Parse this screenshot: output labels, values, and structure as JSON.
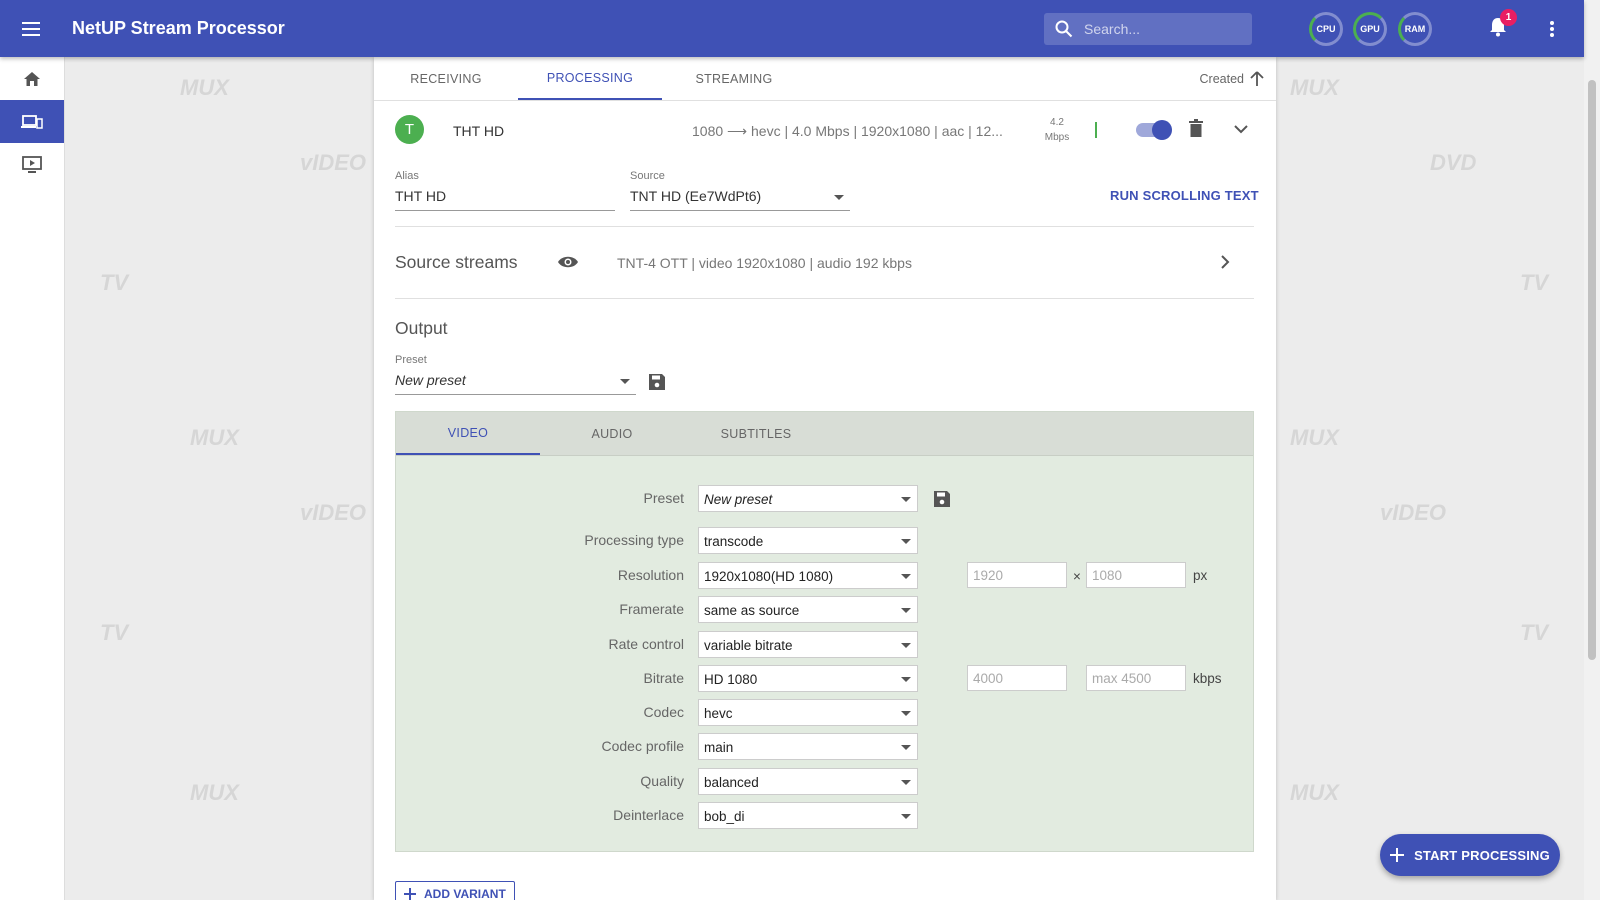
{
  "app": {
    "title": "NetUP Stream Processor"
  },
  "search": {
    "placeholder": "Search..."
  },
  "gauges": {
    "cpu": "CPU",
    "gpu": "GPU",
    "ram": "RAM"
  },
  "notifications": {
    "count": "1"
  },
  "sidebar": {
    "items": [
      {
        "icon": "home-icon"
      },
      {
        "icon": "devices-icon",
        "active": true
      },
      {
        "icon": "tv-play-icon"
      }
    ]
  },
  "tabs": [
    {
      "label": "RECEIVING"
    },
    {
      "label": "PROCESSING",
      "active": true
    },
    {
      "label": "STREAMING"
    }
  ],
  "sort": {
    "label": "Created"
  },
  "stream": {
    "avatar": "T",
    "name": "THT HD",
    "info": "1080 ⟶ hevc | 4.0 Mbps | 1920x1080 | aac | 12...",
    "bitrate_value": "4.2",
    "bitrate_unit": "Mbps",
    "enabled": true
  },
  "alias": {
    "label": "Alias",
    "value": "THT HD"
  },
  "source": {
    "label": "Source",
    "value": "TNT HD (Ee7WdPt6)"
  },
  "run_scrolling_text": "RUN SCROLLING TEXT",
  "source_streams": {
    "title": "Source streams",
    "info": "TNT-4 OTT   | video 1920x1080   | audio 192 kbps"
  },
  "output": {
    "title": "Output",
    "preset_label": "Preset",
    "preset_value": "New preset"
  },
  "panel": {
    "tabs": [
      {
        "label": "VIDEO",
        "active": true
      },
      {
        "label": "AUDIO"
      },
      {
        "label": "SUBTITLES"
      }
    ],
    "fields": {
      "preset": {
        "label": "Preset",
        "value": "New preset"
      },
      "processing_type": {
        "label": "Processing type",
        "value": "transcode"
      },
      "resolution": {
        "label": "Resolution",
        "value": "1920x1080(HD 1080)",
        "width": "1920",
        "height": "1080",
        "sep": "×",
        "unit": "px"
      },
      "framerate": {
        "label": "Framerate",
        "value": "same as source"
      },
      "rate_control": {
        "label": "Rate control",
        "value": "variable bitrate"
      },
      "bitrate": {
        "label": "Bitrate",
        "value": "HD 1080",
        "min": "4000",
        "max": "max  4500",
        "unit": "kbps"
      },
      "codec": {
        "label": "Codec",
        "value": "hevc"
      },
      "codec_profile": {
        "label": "Codec profile",
        "value": "main"
      },
      "quality": {
        "label": "Quality",
        "value": "balanced"
      },
      "deinterlace": {
        "label": "Deinterlace",
        "value": "bob_di"
      }
    }
  },
  "add_variant": "ADD VARIANT",
  "fab": {
    "label": "START PROCESSING"
  }
}
